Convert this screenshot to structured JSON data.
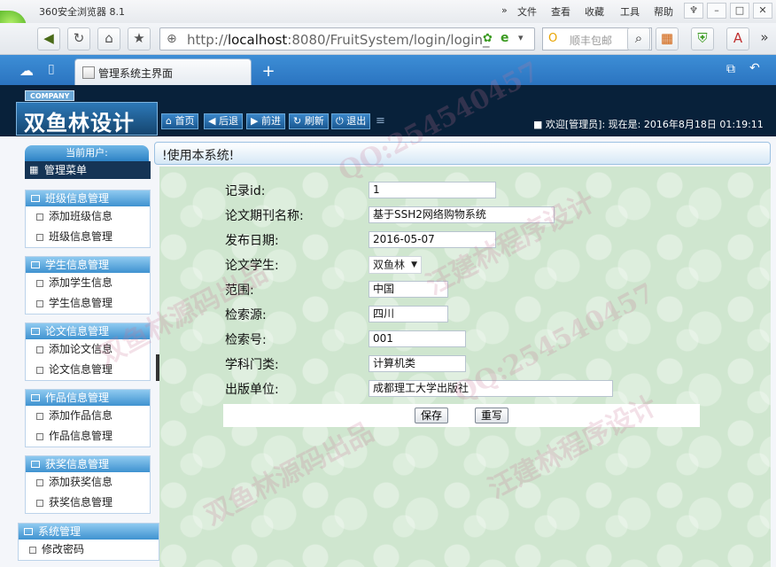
{
  "browser": {
    "title": "360安全浏览器 8.1",
    "menu": [
      "文件",
      "查看",
      "收藏",
      "工具",
      "帮助"
    ],
    "address": {
      "url_prefix": "http://",
      "host": "localhost",
      "rest": ":8080/FruitSystem/login/login_"
    },
    "search_placeholder": "顺丰包邮",
    "tab_title": "管理系统主界面"
  },
  "header": {
    "company_tag": "COMPANY",
    "brand": "双鱼林设计",
    "toolbar": [
      "首页",
      "后退",
      "前进",
      "刷新",
      "退出"
    ],
    "welcome": "欢迎[管理员]:  现在是: 2016年8月18日 01:19:11"
  },
  "sidebar": {
    "current_user_label": "当前用户: ",
    "menu_title": "管理菜单",
    "groups": [
      {
        "title": "班级信息管理",
        "items": [
          "添加班级信息",
          "班级信息管理"
        ]
      },
      {
        "title": "学生信息管理",
        "items": [
          "添加学生信息",
          "学生信息管理"
        ]
      },
      {
        "title": "论文信息管理",
        "items": [
          "添加论文信息",
          "论文信息管理"
        ]
      },
      {
        "title": "作品信息管理",
        "items": [
          "添加作品信息",
          "作品信息管理"
        ]
      },
      {
        "title": "获奖信息管理",
        "items": [
          "添加获奖信息",
          "获奖信息管理"
        ]
      },
      {
        "title": "系统管理",
        "items": [
          "修改密码"
        ]
      }
    ]
  },
  "main": {
    "header_text": "!使用本系统!",
    "fields": [
      {
        "label": "记录id:",
        "value": "1"
      },
      {
        "label": "论文期刊名称:",
        "value": "基于SSH2网络购物系统"
      },
      {
        "label": "发布日期:",
        "value": "2016-05-07"
      },
      {
        "label": "论文学生:",
        "value": "双鱼林"
      },
      {
        "label": "范围:",
        "value": "中国"
      },
      {
        "label": "检索源:",
        "value": "四川"
      },
      {
        "label": "检索号:",
        "value": "001"
      },
      {
        "label": "学科门类:",
        "value": "计算机类"
      },
      {
        "label": "出版单位:",
        "value": "成都理工大学出版社"
      }
    ],
    "save_label": "保存",
    "reset_label": "重写"
  },
  "watermarks": [
    "QQ:254540457",
    "双鱼林源码出品",
    "汪建林程序设计"
  ]
}
